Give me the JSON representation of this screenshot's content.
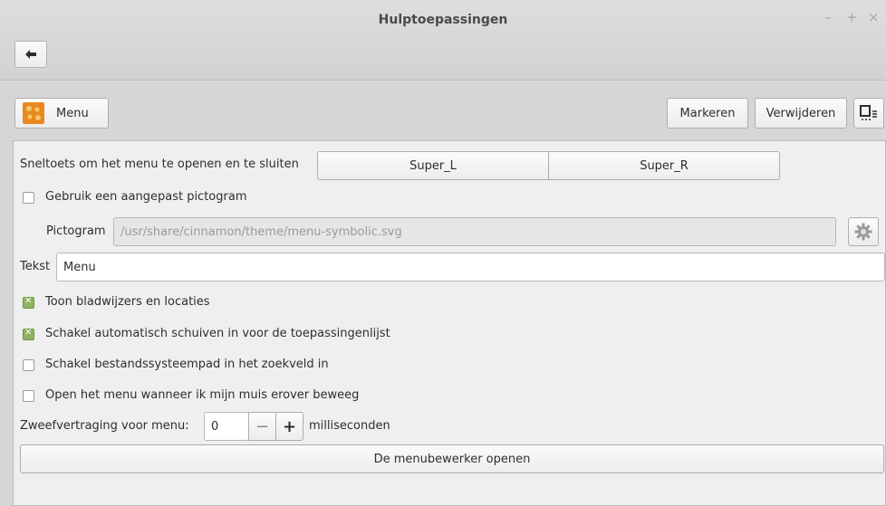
{
  "window": {
    "title": "Hulptoepassingen",
    "controls": {
      "minimize": "–",
      "maximize": "+",
      "close": "×"
    }
  },
  "toolbar": {
    "menu_button_label": "Menu",
    "highlight_label": "Markeren",
    "remove_label": "Verwijderen"
  },
  "settings": {
    "hotkey_label": "Sneltoets om het menu te openen en te sluiten",
    "hotkey_primary": "Super_L",
    "hotkey_secondary": "Super_R",
    "custom_icon_label": "Gebruik een aangepast pictogram",
    "custom_icon_checked": false,
    "icon_label": "Pictogram",
    "icon_path": "/usr/share/cinnamon/theme/menu-symbolic.svg",
    "text_label": "Tekst",
    "text_value": "Menu",
    "show_bookmarks_label": "Toon bladwijzers en locaties",
    "show_bookmarks_checked": true,
    "autoscroll_label": "Schakel automatisch schuiven in voor de toepassingenlijst",
    "autoscroll_checked": true,
    "filesystem_path_label": "Schakel bestandssysteempad in het zoekveld in",
    "filesystem_path_checked": false,
    "open_on_hover_label": "Open het menu wanneer ik mijn muis erover beweeg",
    "open_on_hover_checked": false,
    "hover_delay_label": "Zweefvertraging voor menu:",
    "hover_delay_value": "0",
    "hover_delay_unit": "milliseconden",
    "minus_label": "−",
    "plus_label": "+",
    "open_editor_label": "De menubewerker openen"
  }
}
